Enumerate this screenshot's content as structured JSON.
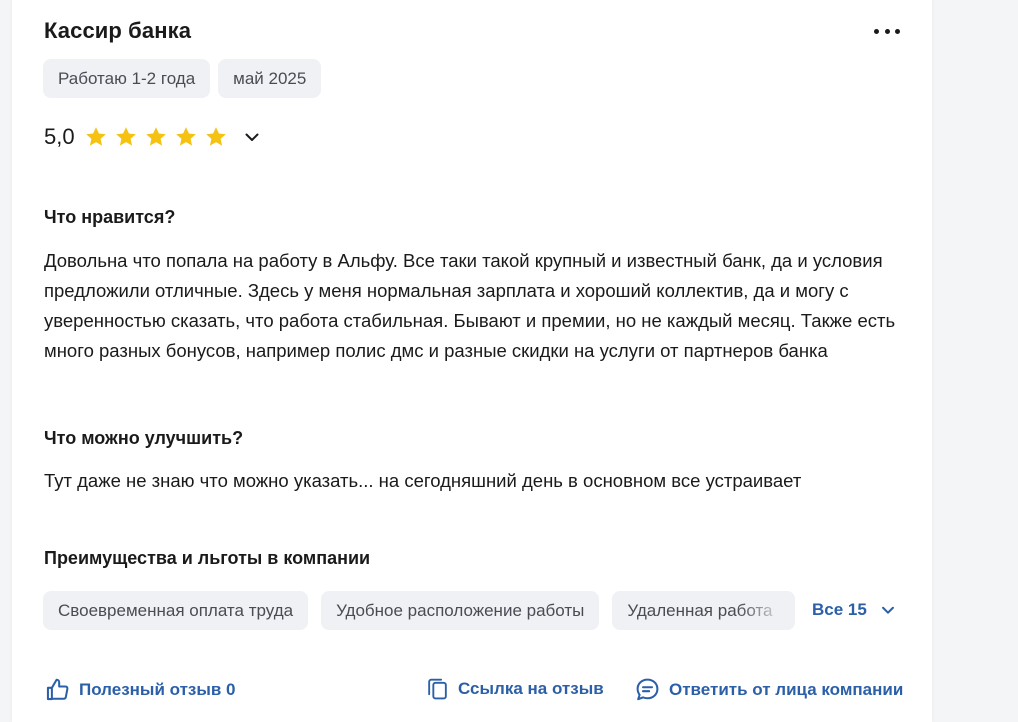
{
  "review": {
    "title": "Кассир банка",
    "tags": [
      "Работаю 1-2 года",
      "май 2025"
    ],
    "rating": "5,0",
    "stars_filled": 5,
    "stars_total": 5
  },
  "likes": {
    "title": "Что нравится?",
    "text": "Довольна что попала на работу в Альфу. Все таки такой крупный и известный банк, да и условия предложили отличные. Здесь у меня нормальная зарплата и хороший коллектив, да и могу с уверенностью сказать, что работа стабильная. Бывают и премии, но не каждый месяц. Также есть много разных бонусов, например полис дмс и разные скидки на услуги от партнеров банка"
  },
  "improve": {
    "title": "Что можно улучшить?",
    "text": "Тут даже не знаю что можно указать... на сегодняшний день в основном все устраивает"
  },
  "benefits": {
    "title": "Преимущества и льготы в компании",
    "items": [
      "Своевременная оплата труда",
      "Удобное расположение работы",
      "Удаленная работа"
    ],
    "all_label": "Все 15"
  },
  "actions": {
    "helpful": "Полезный отзыв 0",
    "link": "Ссылка на отзыв",
    "reply": "Ответить от лица компании"
  },
  "colors": {
    "link": "#2b5fa8",
    "star": "#f5c211",
    "tag_bg": "#f0f1f4"
  },
  "icons": {
    "more": "more-horizontal-icon",
    "star": "star-icon",
    "chevron": "chevron-down-icon",
    "thumb": "thumbs-up-icon",
    "copy": "copy-icon",
    "chat": "chat-bubble-icon"
  }
}
